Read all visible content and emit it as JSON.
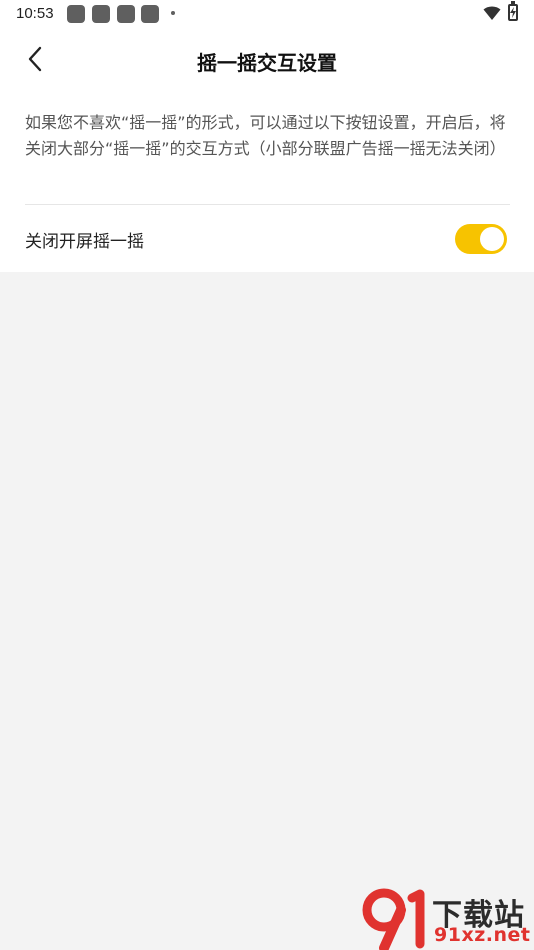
{
  "status_bar": {
    "time": "10:53"
  },
  "header": {
    "title": "摇一摇交互设置",
    "back_icon": "chevron-left-icon"
  },
  "content": {
    "description": "如果您不喜欢“摇一摇”的形式，可以通过以下按钮设置，开启后，将关闭大部分“摇一摇”的交互方式（小部分联盟广告摇一摇无法关闭）",
    "setting": {
      "label": "关闭开屏摇一摇",
      "enabled": true
    }
  },
  "colors": {
    "toggle_on": "#f7c300",
    "background": "#f3f3f3"
  },
  "watermark": {
    "title": "下载站",
    "domain": "91xz.net"
  }
}
